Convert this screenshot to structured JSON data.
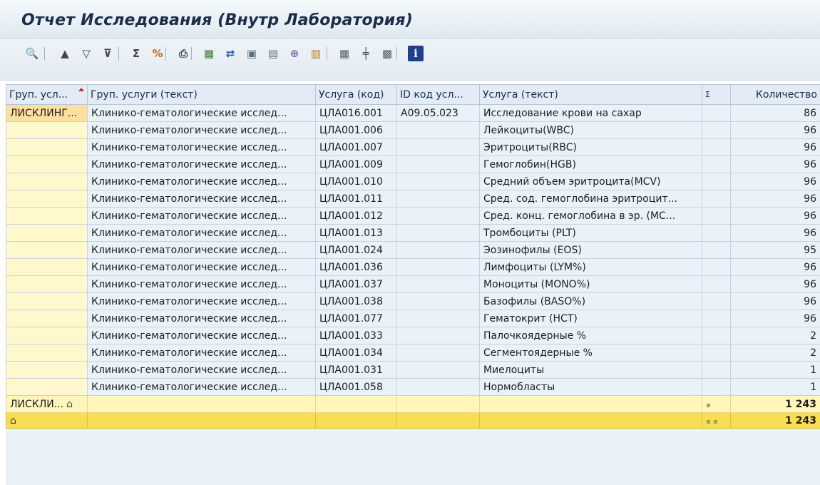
{
  "window": {
    "title": "Отчет Исследования (Внутр Лаборатория)"
  },
  "toolbar": [
    {
      "name": "details-icon",
      "glyph": "🔍",
      "color": "#2a4a78"
    },
    {
      "name": "sort-ascending-icon",
      "glyph": "▲",
      "color": "#444444"
    },
    {
      "name": "filter-icon",
      "glyph": "▽",
      "color": "#444444"
    },
    {
      "name": "filter-delete-icon",
      "glyph": "⊽",
      "color": "#444444"
    },
    {
      "name": "sum-icon",
      "glyph": "Σ",
      "color": "#444444"
    },
    {
      "name": "subtotal-icon",
      "glyph": "%",
      "color": "#c26b11"
    },
    {
      "name": "print-preview-icon",
      "glyph": "⎙",
      "color": "#444444"
    },
    {
      "name": "export-excel-icon",
      "glyph": "▦",
      "color": "#3f7a34"
    },
    {
      "name": "export-word-icon",
      "glyph": "⇄",
      "color": "#2d5fa6"
    },
    {
      "name": "export-local-icon",
      "glyph": "▣",
      "color": "#5b6d80"
    },
    {
      "name": "layout-icon",
      "glyph": "▤",
      "color": "#5b6d80"
    },
    {
      "name": "abc-analysis-icon",
      "glyph": "⊕",
      "color": "#7a5fa0"
    },
    {
      "name": "graphic-icon",
      "glyph": "▥",
      "color": "#b57b11"
    },
    {
      "name": "choose-layout-icon",
      "glyph": "▦",
      "color": "#4a5a6c"
    },
    {
      "name": "change-layout-icon",
      "glyph": "╪",
      "color": "#4a5a6c"
    },
    {
      "name": "save-layout-icon",
      "glyph": "▩",
      "color": "#4a5a6c"
    },
    {
      "name": "information-icon",
      "glyph": "i",
      "color": "#ffffff"
    }
  ],
  "columns": [
    {
      "key": "grp",
      "label": "Груп. усл..."
    },
    {
      "key": "grp_text",
      "label": "Груп. услуги (текст)"
    },
    {
      "key": "code",
      "label": "Услуга (код)"
    },
    {
      "key": "id",
      "label": "ID код усл..."
    },
    {
      "key": "text",
      "label": "Услуга (текст)"
    },
    {
      "key": "sigma",
      "label": "Σ"
    },
    {
      "key": "qty",
      "label": "Количество"
    }
  ],
  "rows": [
    {
      "grp": "ЛИСКЛИНГ...",
      "grp_text": "Клинико-гематологические исслед...",
      "code": "ЦЛА016.001",
      "id": "A09.05.023",
      "text": "Исследование крови на сахар",
      "qty": "86"
    },
    {
      "grp": "",
      "grp_text": "Клинико-гематологические исслед...",
      "code": "ЦЛА001.006",
      "id": "",
      "text": "Лейкоциты(WBC)",
      "qty": "96"
    },
    {
      "grp": "",
      "grp_text": "Клинико-гематологические исслед...",
      "code": "ЦЛА001.007",
      "id": "",
      "text": "Эритроциты(RBC)",
      "qty": "96"
    },
    {
      "grp": "",
      "grp_text": "Клинико-гематологические исслед...",
      "code": "ЦЛА001.009",
      "id": "",
      "text": "Гемоглобин(HGB)",
      "qty": "96"
    },
    {
      "grp": "",
      "grp_text": "Клинико-гематологические исслед...",
      "code": "ЦЛА001.010",
      "id": "",
      "text": "Средний объем эритроцита(MCV)",
      "qty": "96"
    },
    {
      "grp": "",
      "grp_text": "Клинико-гематологические исслед...",
      "code": "ЦЛА001.011",
      "id": "",
      "text": "Сред. сод. гемоглобина эритроцит...",
      "qty": "96"
    },
    {
      "grp": "",
      "grp_text": "Клинико-гематологические исслед...",
      "code": "ЦЛА001.012",
      "id": "",
      "text": "Сред. конц. гемоглобина в эр. (МС...",
      "qty": "96"
    },
    {
      "grp": "",
      "grp_text": "Клинико-гематологические исслед...",
      "code": "ЦЛА001.013",
      "id": "",
      "text": "Тромбоциты (PLT)",
      "qty": "96"
    },
    {
      "grp": "",
      "grp_text": "Клинико-гематологические исслед...",
      "code": "ЦЛА001.024",
      "id": "",
      "text": "Эозинофилы (EOS)",
      "qty": "95"
    },
    {
      "grp": "",
      "grp_text": "Клинико-гематологические исслед...",
      "code": "ЦЛА001.036",
      "id": "",
      "text": "Лимфоциты (LYM%)",
      "qty": "96"
    },
    {
      "grp": "",
      "grp_text": "Клинико-гематологические исслед...",
      "code": "ЦЛА001.037",
      "id": "",
      "text": "Моноциты (MONO%)",
      "qty": "96"
    },
    {
      "grp": "",
      "grp_text": "Клинико-гематологические исслед...",
      "code": "ЦЛА001.038",
      "id": "",
      "text": "Базофилы (BASO%)",
      "qty": "96"
    },
    {
      "grp": "",
      "grp_text": "Клинико-гематологические исслед...",
      "code": "ЦЛА001.077",
      "id": "",
      "text": "Гематокрит (HCT)",
      "qty": "96"
    },
    {
      "grp": "",
      "grp_text": "Клинико-гематологические исслед...",
      "code": "ЦЛА001.033",
      "id": "",
      "text": "Палочкоядерные %",
      "qty": "2"
    },
    {
      "grp": "",
      "grp_text": "Клинико-гематологические исслед...",
      "code": "ЦЛА001.034",
      "id": "",
      "text": "Сегментоядерные %",
      "qty": "2"
    },
    {
      "grp": "",
      "grp_text": "Клинико-гематологические исслед...",
      "code": "ЦЛА001.031",
      "id": "",
      "text": "Миелоциты",
      "qty": "1"
    },
    {
      "grp": "",
      "grp_text": "Клинико-гематологические исслед...",
      "code": "ЦЛА001.058",
      "id": "",
      "text": "Нормобласты",
      "qty": "1"
    }
  ],
  "subtotal": {
    "label": "ЛИСКЛИ...",
    "marker": "▪",
    "value": "1 243"
  },
  "total": {
    "marker": "▪ ▪",
    "value": "1 243"
  }
}
